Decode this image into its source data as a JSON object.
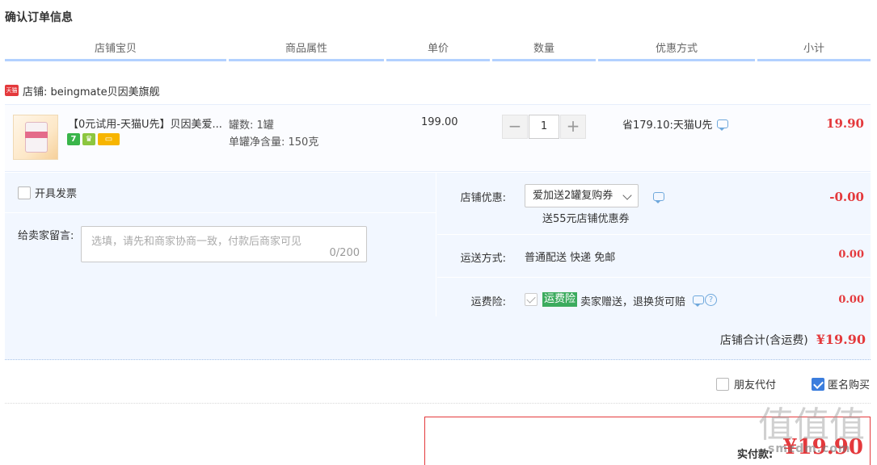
{
  "page": {
    "title": "确认订单信息"
  },
  "columns": [
    "店铺宝贝",
    "商品属性",
    "单价",
    "数量",
    "优惠方式",
    "小计"
  ],
  "shop": {
    "icon_label": "天猫",
    "label": "店铺: beingmate贝因美旗舰"
  },
  "item": {
    "title": "【0元试用-天猫U先】贝因美爱...",
    "badges": [
      "7",
      "♛",
      "▭"
    ],
    "attr_count": "罐数: 1罐",
    "attr_weight": "单罐净含量: 150克",
    "price": "199.00",
    "quantity": "1",
    "qty_minus": "−",
    "qty_plus": "+",
    "discount": "省179.10:天猫U先",
    "subtotal": "19.90"
  },
  "options": {
    "invoice_label": "开具发票",
    "message_label": "给卖家留言:",
    "message_placeholder": "选填，请先和商家协商一致，付款后商家可见",
    "message_count": "0/200",
    "coupon_label": "店铺优惠:",
    "coupon_selected": "爱加送2罐复购券",
    "coupon_sub": "送55元店铺优惠券",
    "coupon_amount": "-0.00",
    "shipping_label": "运送方式:",
    "shipping_value": "普通配送 快递 免邮",
    "shipping_amount": "0.00",
    "insurance_label": "运费险:",
    "insurance_tag": "运费险",
    "insurance_text": "卖家赠送，退换货可赔",
    "insurance_amount": "0.00",
    "help_glyph": "?",
    "shop_total_label": "店铺合计(含运费)",
    "shop_total_amount": "¥19.90"
  },
  "footer": {
    "friend_pay_label": "朋友代付",
    "anonymous_label": "匿名购买",
    "anonymous_checked": true,
    "pay_label": "实付款:",
    "pay_amount": "¥19.90"
  },
  "watermark": {
    "glyphs": "值值值",
    "site": "smzdm.com"
  },
  "colors": {
    "accent_red": "#e4393c",
    "header_line": "#b2d1ff",
    "panel_bg": "#f2f7ff",
    "checkbox_blue": "#3b7ddd",
    "insurance_green": "#3cab5e"
  }
}
